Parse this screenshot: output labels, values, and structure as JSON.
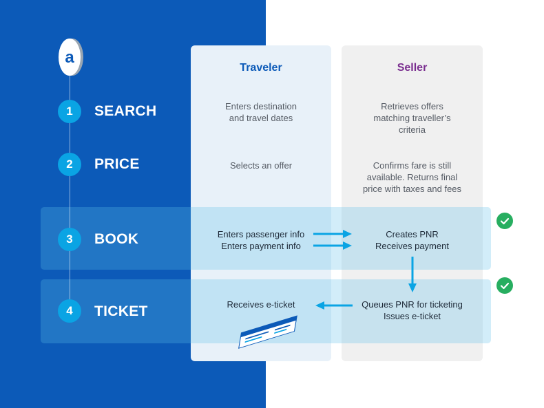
{
  "colors": {
    "brand": "#0c5ab8",
    "accent": "#0aa4e4",
    "traveler_head": "#0c5ab8",
    "seller_head": "#7a2e8f",
    "check": "#27ae60"
  },
  "logo": {
    "letter": "a"
  },
  "columns": {
    "traveler": "Traveler",
    "seller": "Seller"
  },
  "steps": [
    {
      "number": "1",
      "label": "SEARCH",
      "traveler": [
        "Enters destination",
        "and travel dates"
      ],
      "seller": [
        "Retrieves offers",
        "matching traveller’s",
        "criteria"
      ]
    },
    {
      "number": "2",
      "label": "PRICE",
      "traveler": [
        "Selects an offer"
      ],
      "seller": [
        "Confirms fare is still",
        "available. Returns final",
        "price with taxes and fees"
      ]
    },
    {
      "number": "3",
      "label": "BOOK",
      "traveler": [
        "Enters passenger info",
        "Enters payment info"
      ],
      "seller": [
        "Creates PNR",
        "Receives payment"
      ]
    },
    {
      "number": "4",
      "label": "TICKET",
      "traveler": [
        "Receives e-ticket"
      ],
      "seller": [
        "Queues PNR for ticketing",
        "Issues e-ticket"
      ]
    }
  ]
}
